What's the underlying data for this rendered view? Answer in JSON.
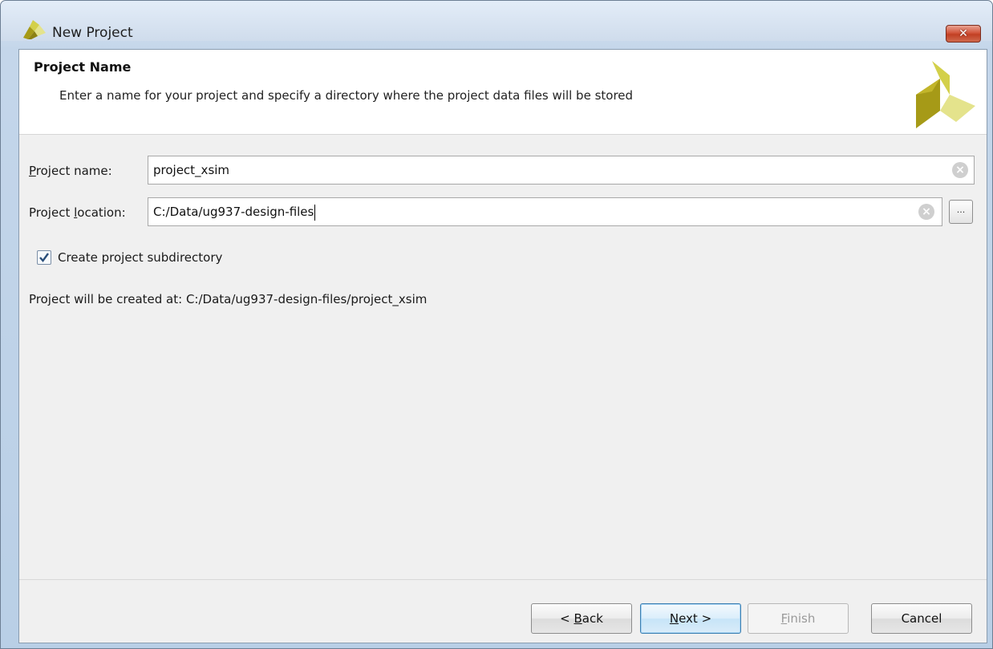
{
  "window": {
    "title": "New Project",
    "close_glyph": "✕"
  },
  "header": {
    "title": "Project Name",
    "description": "Enter a name for your project and specify a directory where the project data files will be stored"
  },
  "form": {
    "project_name": {
      "label_mnemonic": "P",
      "label_rest": "roject name:",
      "value": "project_xsim"
    },
    "project_location": {
      "label_pre": "Project ",
      "label_mnemonic": "l",
      "label_post": "ocation:",
      "value": "C:/Data/ug937-design-files",
      "browse_label": "..."
    },
    "create_subdirectory": {
      "label": "Create project subdirectory",
      "checked": true
    },
    "created_at_text": "Project will be created at: C:/Data/ug937-design-files/project_xsim",
    "clear_glyph": "×"
  },
  "buttons": {
    "back": {
      "pre": "< ",
      "mnemonic": "B",
      "post": "ack"
    },
    "next": {
      "mnemonic": "N",
      "post": "ext >"
    },
    "finish": {
      "mnemonic": "F",
      "post": "inish"
    },
    "cancel": "Cancel"
  },
  "colors": {
    "logo_dark": "#a69a17",
    "logo_light": "#e4e38c",
    "logo_mid": "#d3d04a"
  },
  "icons": [
    "app-logo-icon",
    "close-icon",
    "clear-icon",
    "browse-icon",
    "checkmark-icon",
    "xilinx-logo-icon"
  ]
}
